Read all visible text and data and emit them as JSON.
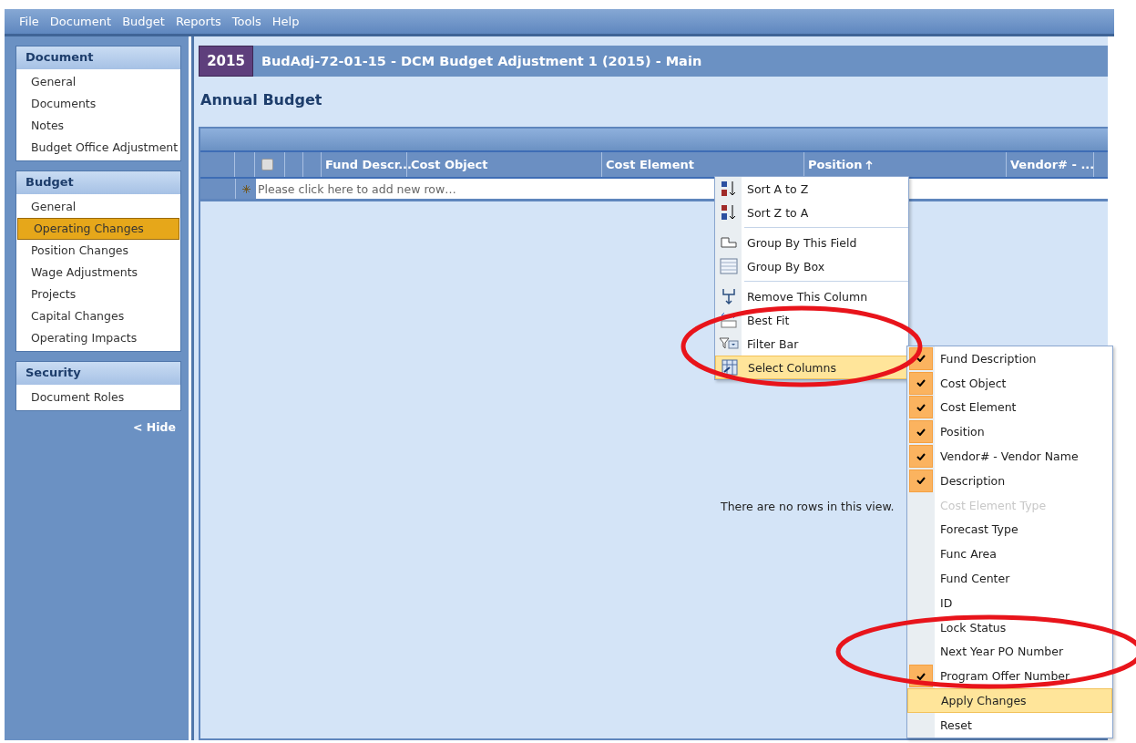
{
  "menu_bar": [
    "File",
    "Document",
    "Budget",
    "Reports",
    "Tools",
    "Help"
  ],
  "sidebar": {
    "sections": [
      {
        "title": "Document",
        "items": [
          {
            "label": "General",
            "selected": false
          },
          {
            "label": "Documents",
            "selected": false
          },
          {
            "label": "Notes",
            "selected": false
          },
          {
            "label": "Budget Office Adjustment",
            "selected": false
          }
        ]
      },
      {
        "title": "Budget",
        "items": [
          {
            "label": "General",
            "selected": false
          },
          {
            "label": "Operating Changes",
            "selected": true
          },
          {
            "label": "Position Changes",
            "selected": false
          },
          {
            "label": "Wage Adjustments",
            "selected": false
          },
          {
            "label": "Projects",
            "selected": false
          },
          {
            "label": "Capital Changes",
            "selected": false
          },
          {
            "label": "Operating Impacts",
            "selected": false
          }
        ]
      },
      {
        "title": "Security",
        "items": [
          {
            "label": "Document Roles",
            "selected": false
          }
        ]
      }
    ],
    "hide_link": "< Hide"
  },
  "document": {
    "year": "2015",
    "title": "BudAdj-72-01-15 - DCM Budget Adjustment 1 (2015) - Main"
  },
  "section_title": "Annual Budget",
  "grid": {
    "select_all_checked": false,
    "columns": [
      {
        "label": "Fund Descr...",
        "sorted": false
      },
      {
        "label": "Cost Object",
        "sorted": false
      },
      {
        "label": "Cost Element",
        "sorted": false
      },
      {
        "label": "Position",
        "sorted": true
      },
      {
        "label": "Vendor# - ...",
        "sorted": false
      }
    ],
    "new_row_placeholder": "Please click here to add new row…",
    "empty_message": "There are no rows in this view."
  },
  "context_menu": {
    "groups": [
      [
        {
          "label": "Sort A to Z",
          "kind": "sort-asc",
          "highlighted": false
        },
        {
          "label": "Sort Z to A",
          "kind": "sort-desc",
          "highlighted": false
        }
      ],
      [
        {
          "label": "Group By This Field",
          "kind": "group-field",
          "highlighted": false
        },
        {
          "label": "Group By Box",
          "kind": "group-box",
          "highlighted": false
        }
      ],
      [
        {
          "label": "Remove This Column",
          "kind": "remove",
          "highlighted": false
        },
        {
          "label": "Best Fit",
          "kind": "best-fit",
          "highlighted": false
        },
        {
          "label": "Filter Bar",
          "kind": "filter",
          "highlighted": false
        },
        {
          "label": "Select Columns",
          "kind": "columns",
          "highlighted": true
        }
      ]
    ]
  },
  "columns_submenu": {
    "columns": [
      {
        "label": "Fund Description",
        "checked": true,
        "disabled": false
      },
      {
        "label": "Cost Object",
        "checked": true,
        "disabled": false
      },
      {
        "label": "Cost Element",
        "checked": true,
        "disabled": false
      },
      {
        "label": "Position",
        "checked": true,
        "disabled": false
      },
      {
        "label": "Vendor# - Vendor Name",
        "checked": true,
        "disabled": false
      },
      {
        "label": "Description",
        "checked": true,
        "disabled": false
      },
      {
        "label": "Cost Element Type",
        "checked": false,
        "disabled": true
      },
      {
        "label": "Forecast Type",
        "checked": false,
        "disabled": false
      },
      {
        "label": "Func Area",
        "checked": false,
        "disabled": false
      },
      {
        "label": "Fund Center",
        "checked": false,
        "disabled": false
      },
      {
        "label": "ID",
        "checked": false,
        "disabled": false
      },
      {
        "label": "Lock Status",
        "checked": false,
        "disabled": false
      },
      {
        "label": "Next Year PO Number",
        "checked": false,
        "disabled": false
      },
      {
        "label": "Program Offer Number",
        "checked": true,
        "disabled": false
      }
    ],
    "actions": [
      {
        "label": "Apply Changes",
        "highlighted": true
      },
      {
        "label": "Reset",
        "highlighted": false
      }
    ]
  }
}
